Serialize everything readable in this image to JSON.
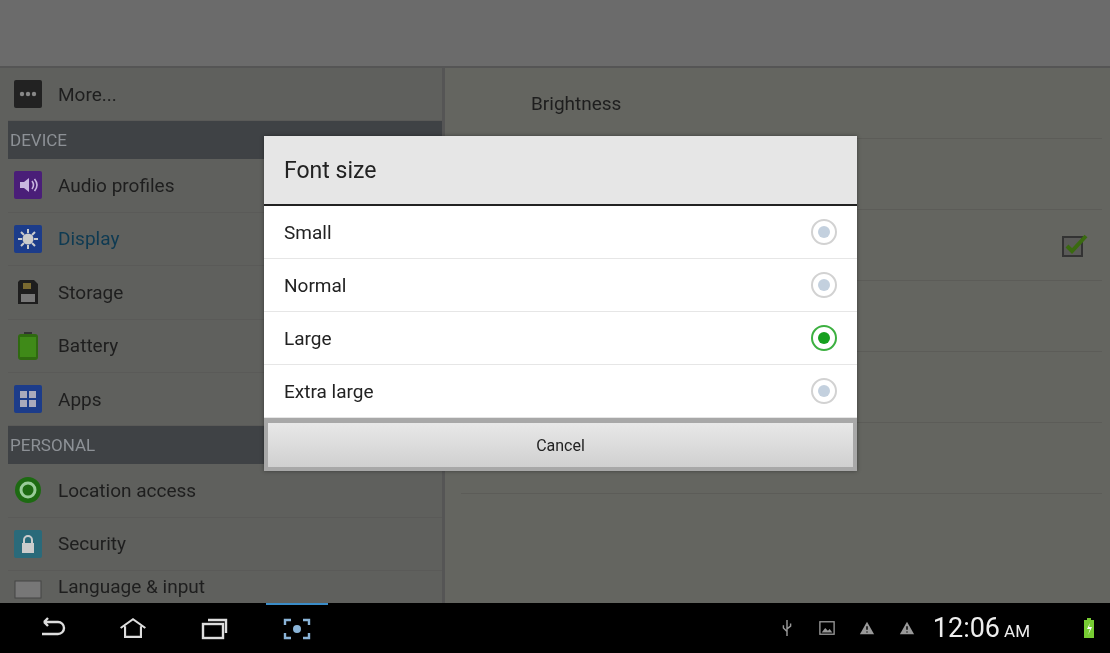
{
  "sidebar": {
    "items": [
      {
        "kind": "item",
        "label": "More...",
        "selected": false
      },
      {
        "kind": "header",
        "label": "DEVICE"
      },
      {
        "kind": "item",
        "label": "Audio profiles",
        "selected": false
      },
      {
        "kind": "item",
        "label": "Display",
        "selected": true
      },
      {
        "kind": "item",
        "label": "Storage",
        "selected": false
      },
      {
        "kind": "item",
        "label": "Battery",
        "selected": false
      },
      {
        "kind": "item",
        "label": "Apps",
        "selected": false
      },
      {
        "kind": "header",
        "label": "PERSONAL"
      },
      {
        "kind": "item",
        "label": "Location access",
        "selected": false
      },
      {
        "kind": "item",
        "label": "Security",
        "selected": false
      },
      {
        "kind": "item",
        "label": "Language & input",
        "selected": false
      }
    ]
  },
  "settings": {
    "brightness": "Brightness",
    "checkbox": {
      "checked": true
    }
  },
  "dialog": {
    "title": "Font size",
    "options": [
      {
        "label": "Small",
        "selected": false
      },
      {
        "label": "Normal",
        "selected": false
      },
      {
        "label": "Large",
        "selected": true
      },
      {
        "label": "Extra large",
        "selected": false
      }
    ],
    "cancel": "Cancel"
  },
  "status_bar": {
    "time": "12:06",
    "ampm": "AM"
  }
}
